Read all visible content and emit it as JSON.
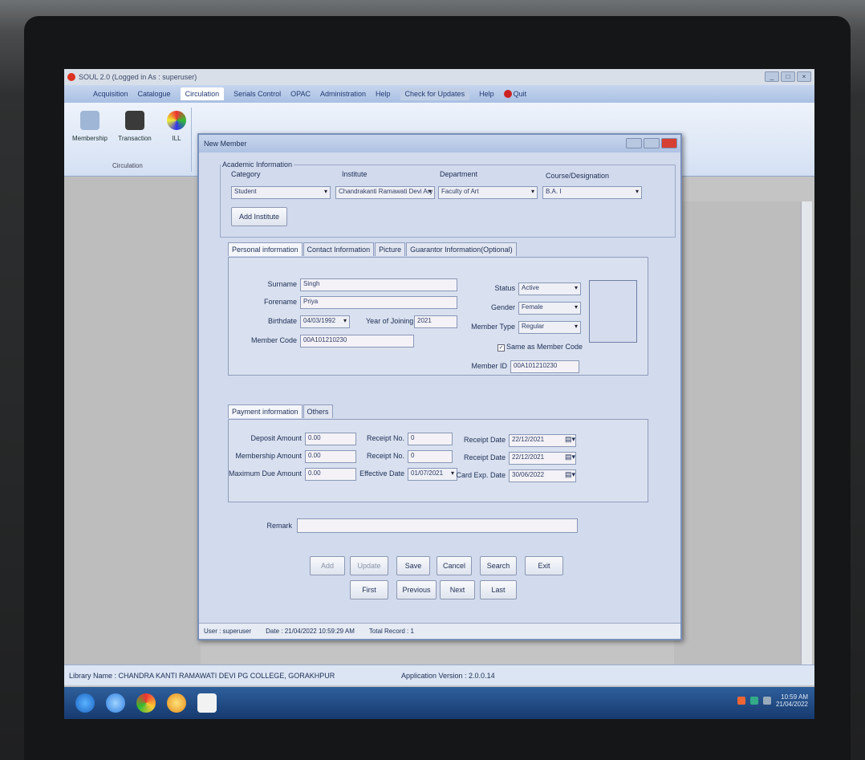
{
  "window": {
    "title": "SOUL 2.0 (Logged in As : superuser)",
    "controls": [
      "_",
      "□",
      "×"
    ]
  },
  "menubar": {
    "items": [
      "Acquisition",
      "Catalogue",
      "Circulation",
      "Serials Control",
      "OPAC",
      "Administration",
      "Help"
    ],
    "active": "Circulation",
    "right_items": [
      "Check for Updates",
      "Help",
      "Quit"
    ]
  },
  "ribbon": {
    "buttons": [
      {
        "label": "Membership",
        "icon": "membership-icon"
      },
      {
        "label": "Transaction",
        "icon": "transaction-icon"
      },
      {
        "label": "ILL",
        "icon": "ill-icon"
      }
    ],
    "group_label": "Circulation"
  },
  "dialog": {
    "title": "New Member",
    "academic": {
      "legend": "Academic Information",
      "category_label": "Category",
      "category_value": "Student",
      "institute_label": "Institute",
      "institute_value": "Chandrakanti Ramawati Devi Ary",
      "department_label": "Department",
      "department_value": "Faculty of Art",
      "course_label": "Course/Designation",
      "course_value": "B.A. I",
      "add_institute": "Add Institute"
    },
    "personal_tabs": [
      "Personal information",
      "Contact Information",
      "Picture",
      "Guarantor Information(Optional)"
    ],
    "personal": {
      "surname_label": "Surname",
      "surname": "Singh",
      "forename_label": "Forename",
      "forename": "Priya",
      "birthdate_label": "Birthdate",
      "birthdate": "04/03/1992",
      "year_label": "Year of Joining",
      "year": "2021",
      "membercode_label": "Member Code",
      "membercode": "00A101210230",
      "status_label": "Status",
      "status": "Active",
      "gender_label": "Gender",
      "gender": "Female",
      "membertype_label": "Member Type",
      "membertype": "Regular",
      "same_label": "Same as Member Code",
      "same_checked": true,
      "memberid_label": "Member ID",
      "memberid": "00A101210230"
    },
    "payment_tabs": [
      "Payment information",
      "Others"
    ],
    "payment": {
      "deposit_label": "Deposit Amount",
      "deposit": "0.00",
      "membership_label": "Membership Amount",
      "membership": "0.00",
      "maxdue_label": "Maximum Due Amount",
      "maxdue": "0.00",
      "receipt_label1": "Receipt No.",
      "receipt1": "0",
      "receipt_label2": "Receipt No.",
      "receipt2": "0",
      "effective_label": "Effective Date",
      "effective": "01/07/2021",
      "rdate_label1": "Receipt Date",
      "rdate1": "22/12/2021",
      "rdate_label2": "Receipt Date",
      "rdate2": "22/12/2021",
      "cardexp_label": "Card Exp. Date",
      "cardexp": "30/06/2022"
    },
    "remark_label": "Remark",
    "remark": "",
    "buttons_row1": [
      "Add",
      "Update",
      "Save",
      "Cancel",
      "Search",
      "Exit"
    ],
    "buttons_row2": [
      "First",
      "Previous",
      "Next",
      "Last"
    ],
    "status": {
      "user": "User : superuser",
      "date": "Date : 21/04/2022 10:59:29 AM",
      "records": "Total Record : 1"
    }
  },
  "statusbar": {
    "library": "Library Name : CHANDRA KANTI RAMAWATI DEVI PG COLLEGE, GORAKHPUR",
    "version": "Application Version : 2.0.0.14"
  },
  "taskbar": {
    "clock_time": "10:59 AM",
    "clock_date": "21/04/2022"
  },
  "colors": {
    "ribbon": "#d4e0f3",
    "dialog": "#d2daed",
    "taskbar": "#173a6e",
    "close": "#d64033"
  }
}
